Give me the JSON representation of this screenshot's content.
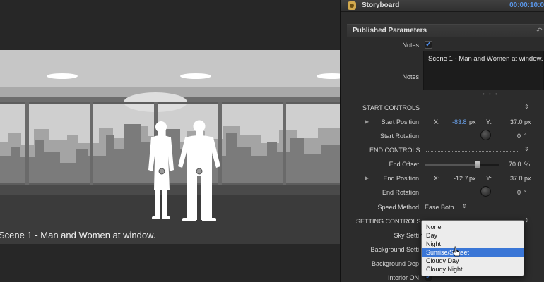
{
  "viewer": {
    "caption": "Scene 1 - Man and Women at window."
  },
  "inspector": {
    "title": "Storyboard",
    "timecode": "00:00:10:0",
    "section_title": "Published Parameters",
    "notes": {
      "label_checkbox": "Notes",
      "label_text": "Notes",
      "text": "Scene 1 - Man and Women at window."
    },
    "start_controls": {
      "header": "START CONTROLS",
      "position_label": "Start Position",
      "x_label": "X:",
      "x_value": "-83.8",
      "x_unit": "px",
      "y_label": "Y:",
      "y_value": "37.0",
      "y_unit": "px",
      "rotation_label": "Start Rotation",
      "rotation_value": "0",
      "rotation_unit": "°"
    },
    "end_controls": {
      "header": "END CONTROLS",
      "offset_label": "End Offset",
      "offset_value": "70.0",
      "offset_unit": "%",
      "offset_fraction": 0.7,
      "position_label": "End Position",
      "x_label": "X:",
      "x_value": "-12.7",
      "x_unit": "px",
      "y_label": "Y:",
      "y_value": "37.0",
      "y_unit": "px",
      "rotation_label": "End Rotation",
      "rotation_value": "0",
      "rotation_unit": "°"
    },
    "speed": {
      "label": "Speed Method",
      "value": "Ease Both"
    },
    "setting_controls": {
      "header": "SETTING CONTROLS",
      "sky_label": "Sky Setti",
      "background_setting_label": "Background Setti",
      "background_depth_label": "Background Dep",
      "interior_label": "Interior ON"
    },
    "sky_menu": {
      "options": [
        "None",
        "Day",
        "Night",
        "Sunrise/Sunset",
        "Cloudy Day",
        "Cloudy Night"
      ],
      "checked": "Day",
      "highlighted": "Sunrise/Sunset"
    }
  },
  "colors": {
    "accent_blue": "#3a76d6",
    "timecode_blue": "#5a96e8",
    "value_blue": "#6aa3ee"
  }
}
